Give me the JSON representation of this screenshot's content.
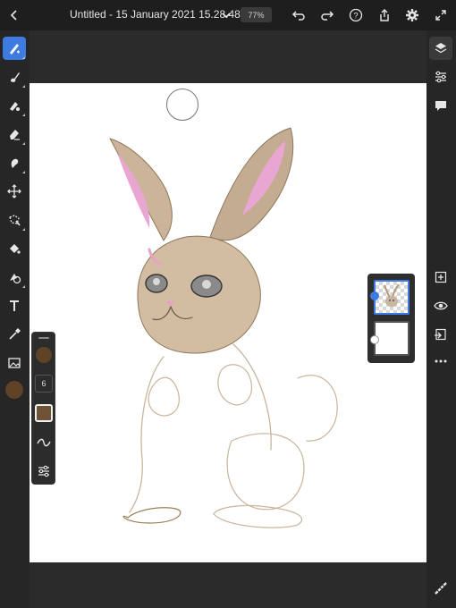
{
  "toolbar": {
    "title": "Untitled - 15 January 2021 15.28.48 *",
    "zoom": "77%",
    "icons": [
      "back-icon",
      "chevron-down-icon",
      "undo-icon",
      "redo-icon",
      "help-icon",
      "share-icon",
      "settings-icon",
      "fullscreen-icon"
    ]
  },
  "left_tools": [
    "brush-tool-icon",
    "pixel-brush-icon",
    "mixer-brush-icon",
    "eraser-icon",
    "smudge-icon",
    "move-icon",
    "lasso-icon",
    "fill-icon",
    "shape-icon",
    "text-icon",
    "eyedropper-icon",
    "image-icon"
  ],
  "right_tools": [
    "layers-icon",
    "adjust-icon",
    "comment-icon",
    "add-layer-icon",
    "visibility-icon",
    "import-icon",
    "more-icon",
    "pen-settings-icon"
  ],
  "brush_panel": {
    "size": "6",
    "color": "#6e5235"
  },
  "colors": {
    "accent": "#3d7be0",
    "current_color": "#5e4326"
  },
  "layers": {
    "count": 2,
    "active_index": 0
  }
}
